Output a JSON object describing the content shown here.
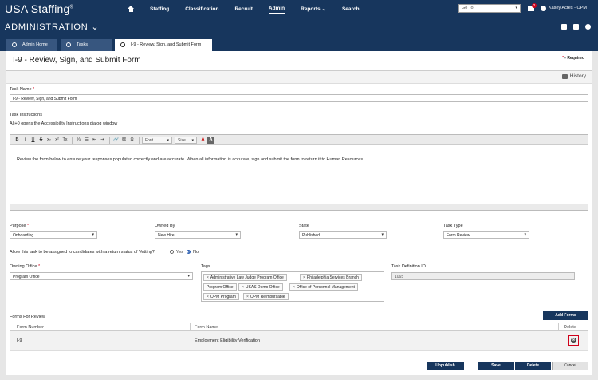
{
  "topnav": {
    "brand": "USA Staffing",
    "brand_mark": "®",
    "items": [
      "Staffing",
      "Classification",
      "Recruit",
      "Admin",
      "Reports",
      "Search"
    ],
    "reports_chevron": "⌄",
    "goto_label": "Go To",
    "mail_count": "2",
    "user": "Kasey Acres - OPM"
  },
  "module": {
    "title": "ADMINISTRATION",
    "chevron": "⌄"
  },
  "tabs": [
    "Admin Home",
    "Tasks",
    "I-9 - Review, Sign, and Submit Form"
  ],
  "page": {
    "title": "I-9 - Review, Sign, and Submit Form",
    "required_mark": "*",
    "required_text": "= Required",
    "history": "History"
  },
  "form": {
    "task_name_label": "Task Name",
    "task_name_value": "I-9 - Review, Sign, and Submit Form",
    "task_instructions_label": "Task Instructions",
    "accessibility_hint": "Alt+0 opens the Accessibility Instructions dialog window",
    "toolbar": {
      "bold": "B",
      "italic": "I",
      "underline": "U",
      "strike": "S",
      "subscript": "x₂",
      "superscript": "x²",
      "clear": "Tx",
      "numbered": "⅓",
      "bulleted": "☰",
      "outdent": "⇤",
      "indent": "⇥",
      "link": "🔗",
      "unlink": "⛓",
      "omega": "Ω",
      "font": "Font",
      "size": "Size",
      "textcolor": "A",
      "bgcolor": "A"
    },
    "instructions_text": "Review the form below to ensure your responses populated correctly and are accurate. When all information is accurate, sign and submit the form to return it to Human Resources.",
    "purpose_label": "Purpose",
    "purpose_value": "Onboarding",
    "owned_by_label": "Owned By",
    "owned_by_value": "New Hire",
    "state_label": "State",
    "state_value": "Published",
    "task_type_label": "Task Type",
    "task_type_value": "Form Review",
    "vetting_question": "Allow this task to be assigned to candidates with a return status of Vetting?",
    "vetting_yes": "Yes",
    "vetting_no": "No",
    "vetting_selected": "No",
    "owning_office_label": "Owning Office",
    "owning_office_value": "Program Office",
    "tags_label": "Tags",
    "tags": [
      "Administrative Law Judge Program Office",
      "Philadelphia Services Branch",
      "Program Office",
      "USAS Demo Office",
      "Office of Personnel Management",
      "OPM Program",
      "OPM Reimbursable"
    ],
    "tag_remove": "×",
    "task_def_label": "Task Definition ID",
    "task_def_value": "1065"
  },
  "forms_review": {
    "label": "Forms For Review",
    "add_button": "Add Forms",
    "columns": [
      "Form Number",
      "Form Name",
      "Delete"
    ],
    "rows": [
      {
        "number": "I-9",
        "name": "Employment Eligibility Verification"
      }
    ]
  },
  "actions": {
    "unpublish": "Unpublish",
    "save": "Save",
    "delete": "Delete",
    "cancel": "Cancel"
  },
  "icons": {
    "home": "home-icon",
    "mail": "mail-icon",
    "user": "user-icon",
    "print": "print-icon",
    "delete": "delete-icon",
    "select_chevron": "▾",
    "delete_glyph": "⊗"
  },
  "colors": {
    "nav": "#17365d",
    "accent": "#2a5db0",
    "required": "#d0021b"
  }
}
